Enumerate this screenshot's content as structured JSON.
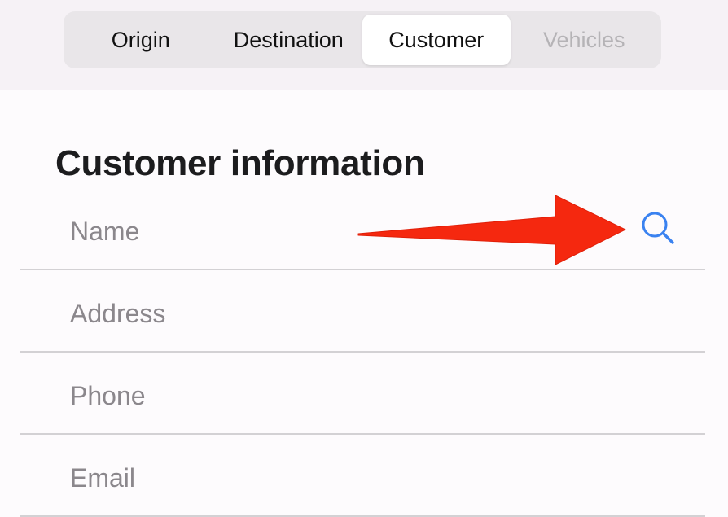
{
  "tabs": [
    {
      "label": "Origin",
      "state": "normal"
    },
    {
      "label": "Destination",
      "state": "normal"
    },
    {
      "label": "Customer",
      "state": "selected"
    },
    {
      "label": "Vehicles",
      "state": "disabled"
    }
  ],
  "section": {
    "title": "Customer information"
  },
  "fields": {
    "name": {
      "placeholder": "Name",
      "value": ""
    },
    "address": {
      "placeholder": "Address",
      "value": ""
    },
    "phone": {
      "placeholder": "Phone",
      "value": ""
    },
    "email": {
      "placeholder": "Email",
      "value": ""
    }
  },
  "icons": {
    "search": "search-icon",
    "annotation": "arrow-annotation"
  },
  "colors": {
    "accent": "#3a82f0",
    "arrow": "#f5280f",
    "placeholder": "#8b878c",
    "disabled": "#b5b3b6"
  }
}
